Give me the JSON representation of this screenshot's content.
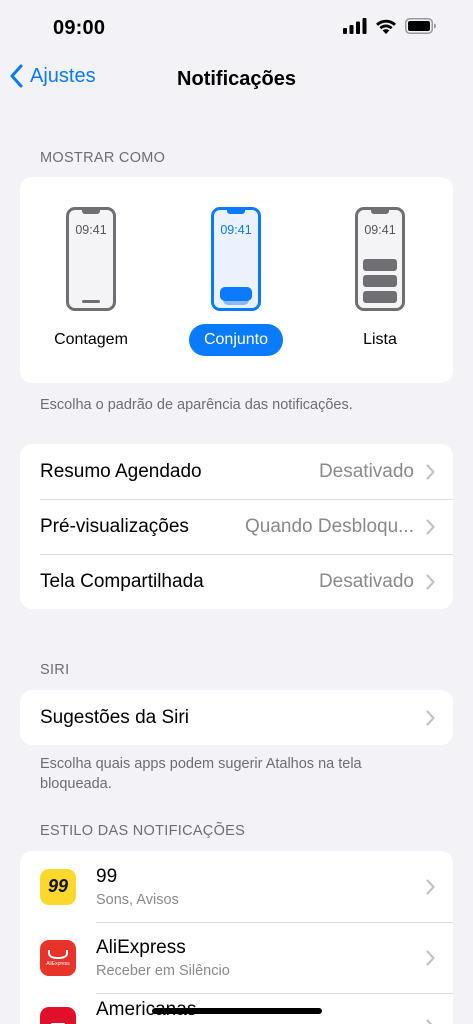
{
  "status_bar": {
    "time": "09:00"
  },
  "nav": {
    "back_label": "Ajustes",
    "title": "Notificações"
  },
  "display_as": {
    "header": "MOSTRAR COMO",
    "options": [
      {
        "label": "Contagem",
        "phone_time": "09:41",
        "selected": false
      },
      {
        "label": "Conjunto",
        "phone_time": "09:41",
        "selected": true
      },
      {
        "label": "Lista",
        "phone_time": "09:41",
        "selected": false
      }
    ],
    "footer": "Escolha o padrão de aparência das notificações."
  },
  "settings_rows": [
    {
      "label": "Resumo Agendado",
      "value": "Desativado"
    },
    {
      "label": "Pré-visualizações",
      "value": "Quando Desbloqu..."
    },
    {
      "label": "Tela Compartilhada",
      "value": "Desativado"
    }
  ],
  "siri": {
    "header": "SIRI",
    "row_label": "Sugestões da Siri",
    "footer": "Escolha quais apps podem sugerir Atalhos na tela bloqueada."
  },
  "notification_style": {
    "header": "ESTILO DAS NOTIFICAÇÕES",
    "apps": [
      {
        "name": "99",
        "subtitle": "Sons, Avisos",
        "icon": "99-app-icon",
        "icon_text": "99"
      },
      {
        "name": "AliExpress",
        "subtitle": "Receber em Silêncio",
        "icon": "aliexpress-app-icon",
        "icon_text": "AliExpress"
      },
      {
        "name": "Americanas",
        "subtitle": "",
        "icon": "americanas-app-icon",
        "icon_text": ""
      }
    ]
  },
  "colors": {
    "accent": "#0a7aff",
    "background": "#f2f2f7",
    "secondary_text": "#8a8a8e"
  }
}
